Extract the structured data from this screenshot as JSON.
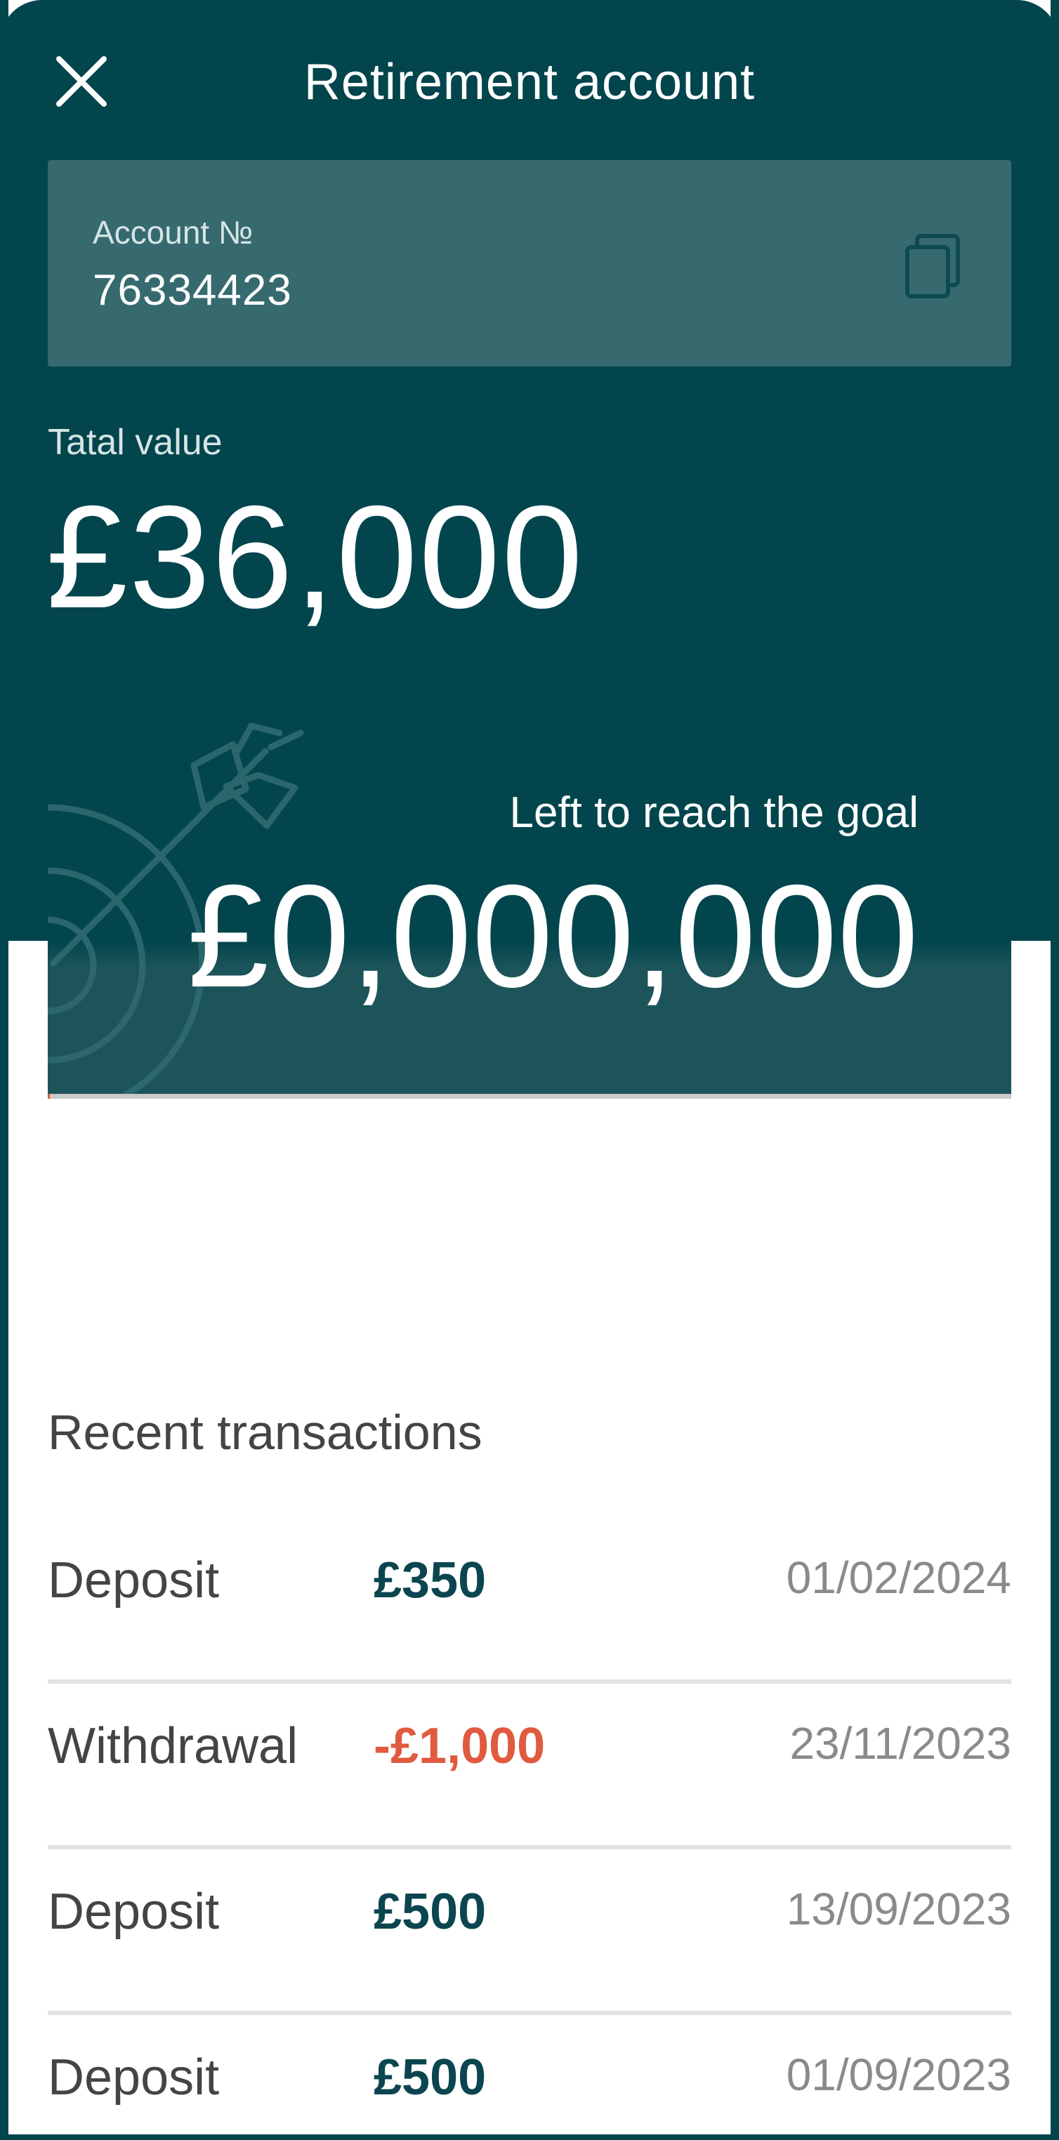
{
  "header": {
    "title": "Retirement account",
    "close_icon": "close-icon"
  },
  "account": {
    "label": "Account №",
    "number": "76334423",
    "copy_icon": "copy-icon"
  },
  "total": {
    "label": "Tatal value",
    "value": "£36,000"
  },
  "goal": {
    "label": "Left to reach the goal",
    "value": "£0,000,000",
    "illustration_icon": "target-arrow-icon",
    "progress_fraction": 0.002
  },
  "transactions": {
    "title": "Recent transactions",
    "items": [
      {
        "type": "Deposit",
        "amount": "£350",
        "date": "01/02/2024",
        "direction": "in"
      },
      {
        "type": "Withdrawal",
        "amount": "-£1,000",
        "date": "23/11/2023",
        "direction": "out"
      },
      {
        "type": "Deposit",
        "amount": "£500",
        "date": "13/09/2023",
        "direction": "in"
      },
      {
        "type": "Deposit",
        "amount": "£500",
        "date": "01/09/2023",
        "direction": "in"
      }
    ]
  },
  "colors": {
    "primary": "#02454d",
    "card": "#366a6f",
    "accent_negative": "#e05a3f",
    "amount_positive": "#0b4550"
  }
}
